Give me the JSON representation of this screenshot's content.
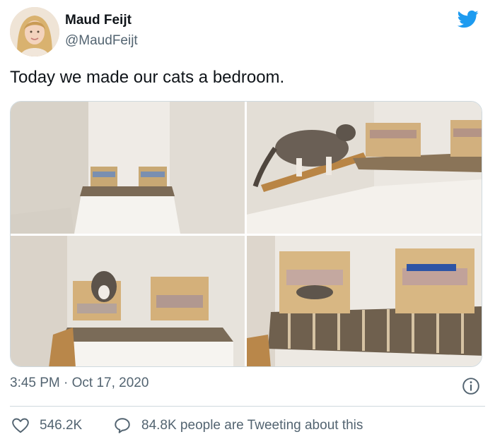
{
  "user": {
    "name": "Maud Feijt",
    "handle": "@MaudFeijt"
  },
  "tweet": {
    "text": "Today we made our cats a bedroom.",
    "timestamp": "3:45 PM · Oct 17, 2020"
  },
  "media": {
    "photo_count": 4
  },
  "metrics": {
    "likes": "546.2K",
    "tweeting": "84.8K people are Tweeting about this"
  },
  "icons": {
    "brand": "twitter-bird-icon",
    "info": "info-icon",
    "like": "heart-icon",
    "reply": "speech-bubble-icon"
  },
  "colors": {
    "brand": "#1d9bf0",
    "text": "#0f1419",
    "secondary": "#536471",
    "border": "#cfd9de"
  }
}
